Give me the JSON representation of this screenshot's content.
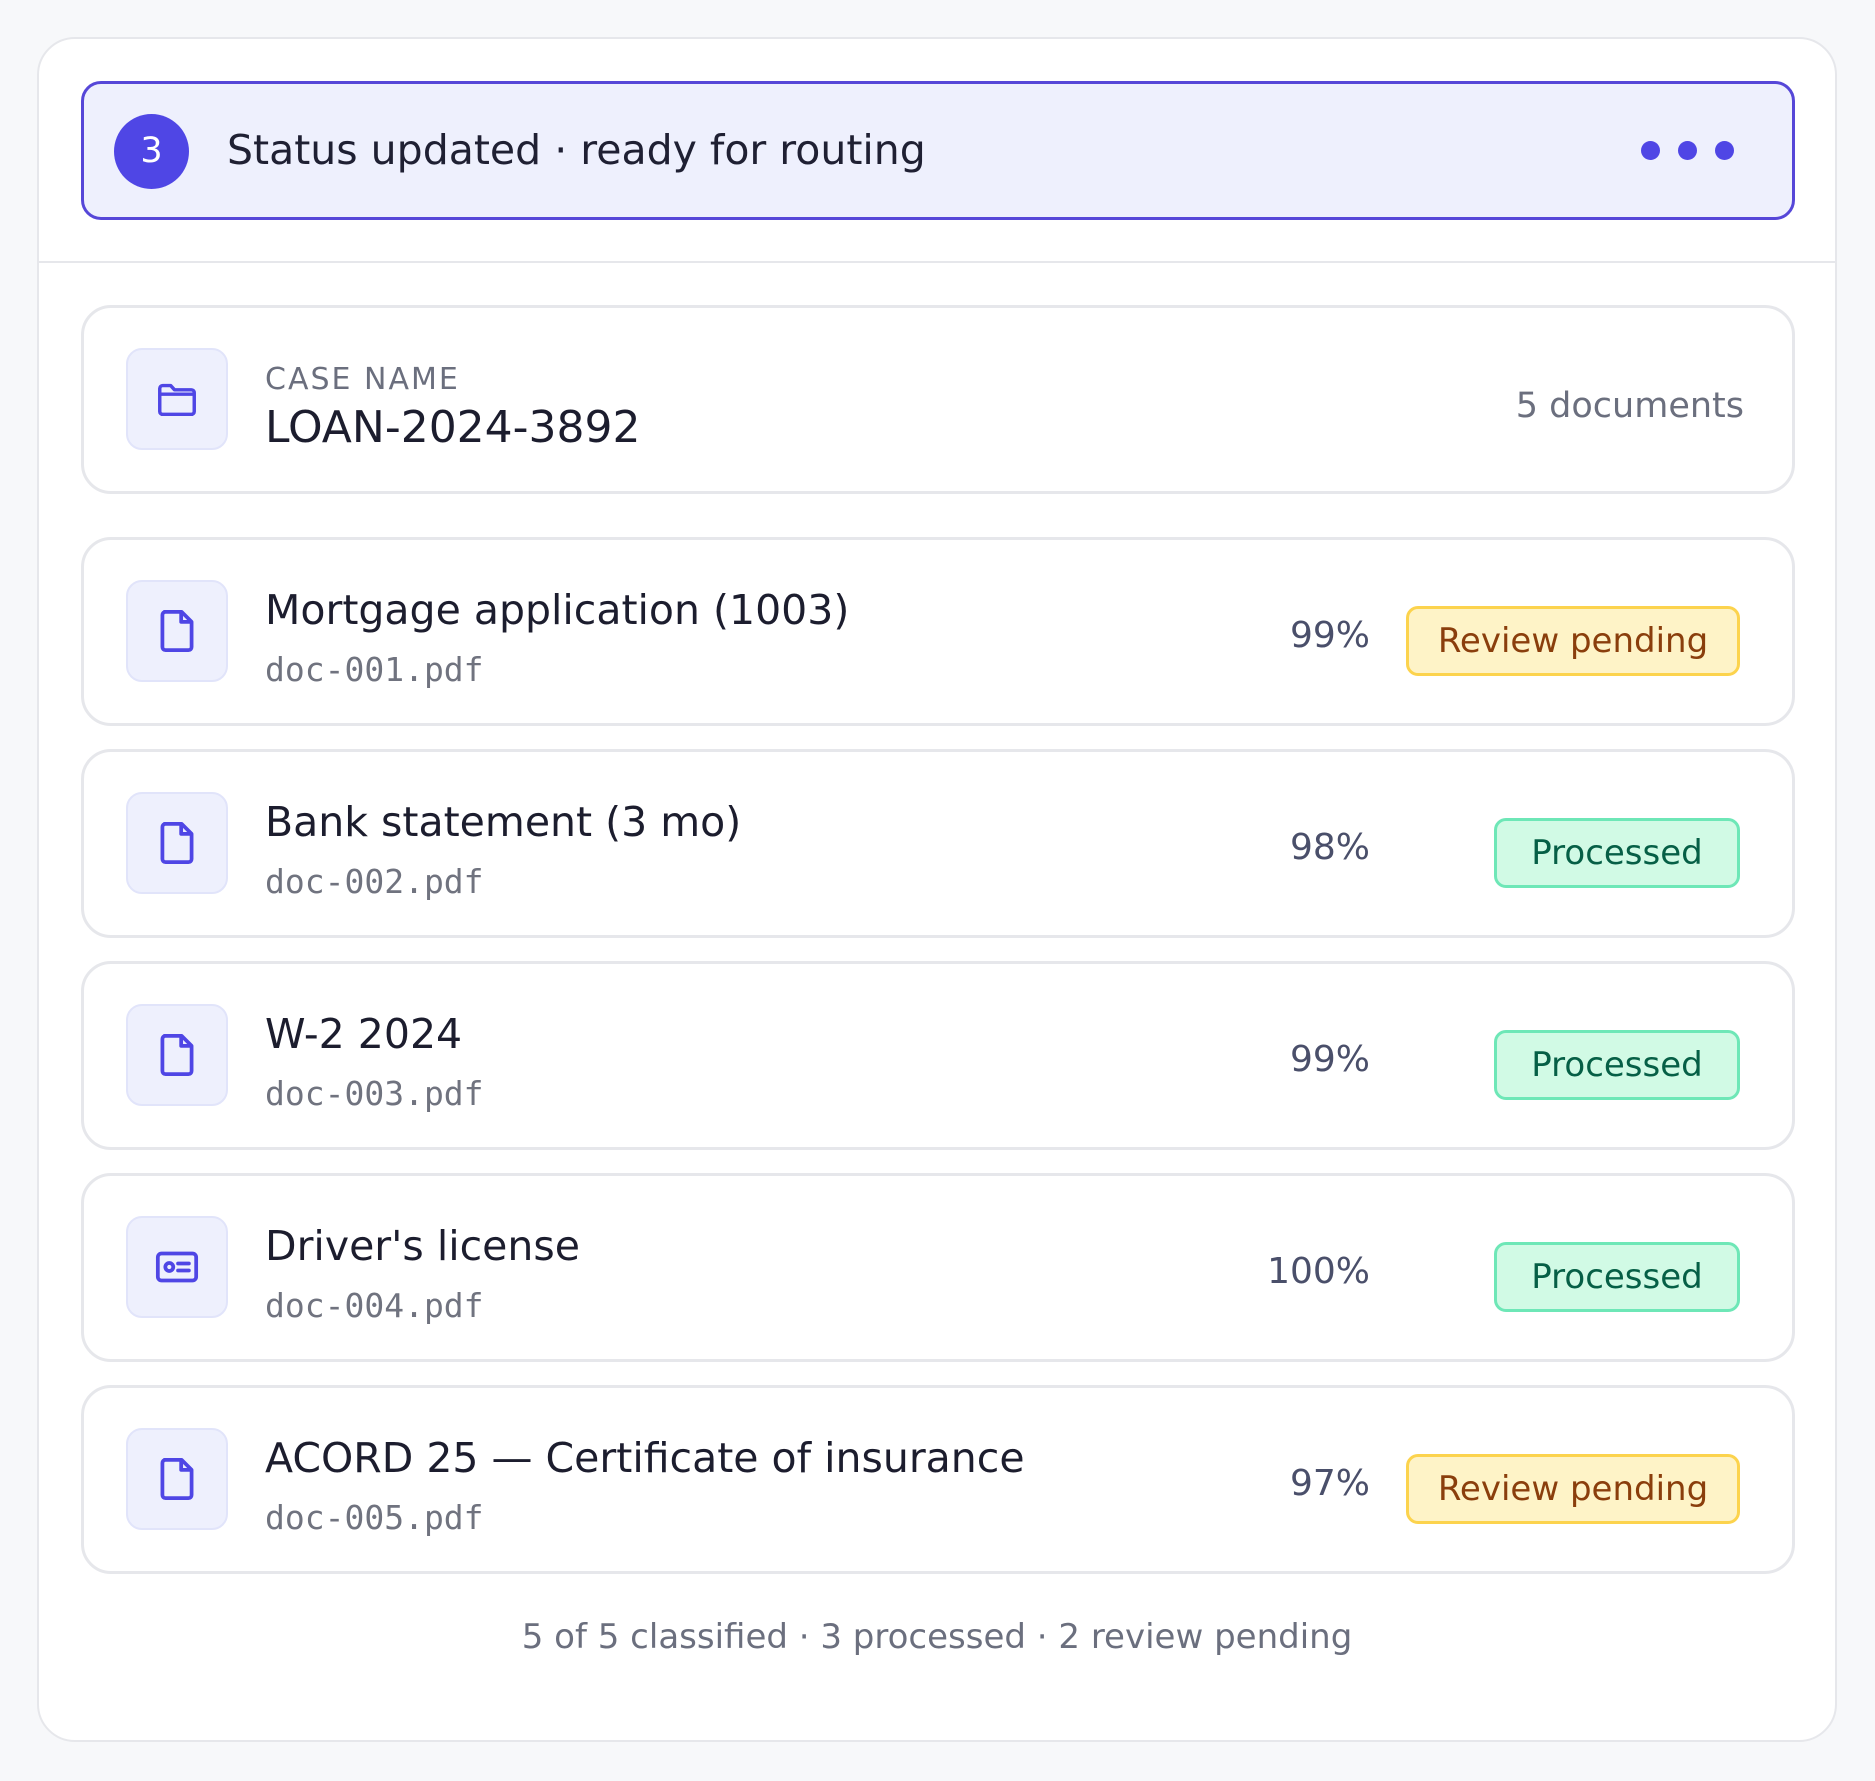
{
  "status": {
    "step": "3",
    "text": "Status updated · ready for routing"
  },
  "case": {
    "label": "CASE NAME",
    "name": "LOAN-2024-3892",
    "count": "5 documents",
    "icon": "folder-icon"
  },
  "documents": [
    {
      "title": "Mortgage application (1003)",
      "file": "doc-001.pdf",
      "confidence": "99%",
      "status": "Review pending",
      "icon": "file-icon"
    },
    {
      "title": "Bank statement (3 mo)",
      "file": "doc-002.pdf",
      "confidence": "98%",
      "status": "Processed",
      "icon": "file-icon"
    },
    {
      "title": "W-2 2024",
      "file": "doc-003.pdf",
      "confidence": "99%",
      "status": "Processed",
      "icon": "file-icon"
    },
    {
      "title": "Driver's license",
      "file": "doc-004.pdf",
      "confidence": "100%",
      "status": "Processed",
      "icon": "id-card-icon"
    },
    {
      "title": "ACORD 25 — Certificate of insurance",
      "file": "doc-005.pdf",
      "confidence": "97%",
      "status": "Review pending",
      "icon": "file-icon"
    }
  ],
  "summary": "5 of 5 classified · 3 processed · 2 review pending",
  "colors": {
    "accent": "#4f46e5",
    "review_bg": "#fef3c7",
    "review_text": "#8a3e0c",
    "processed_bg": "#d1fae5",
    "processed_text": "#065f46"
  }
}
